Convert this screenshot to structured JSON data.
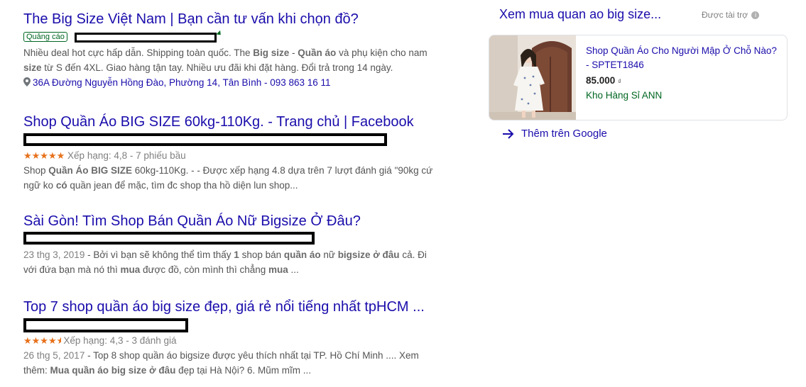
{
  "results": [
    {
      "title": "The Big Size Việt Nam | Bạn cần tư vấn khi chọn đồ?",
      "ad_badge": "Quảng cáo",
      "snippet_line1": "Nhiều deal hot cực hấp dẫn. Shipping toàn quốc. The ",
      "snippet_line1_b1": "Big size",
      "snippet_line1_mid": " - ",
      "snippet_line1_b2": "Quần áo",
      "snippet_line1_end": " và phụ kiện cho nam",
      "snippet_line2_b": "size",
      "snippet_line2": " từ S đến 4XL. Giao hàng tận tay. Nhiều ưu đãi khi đặt hàng. Đổi trả trong 14 ngày.",
      "address": "36A Đường Nguyễn Hồng Đào, Phường 14, Tân Bình - 093 863 16 11"
    },
    {
      "title": "Shop Quần Áo BIG SIZE 60kg-110Kg. - Trang chủ | Facebook",
      "stars": "★★★★★",
      "rating": "Xếp hạng: 4,8 - 7 phiếu bầu",
      "snippet_p1": "Shop ",
      "snippet_b1": "Quần Áo BIG SIZE",
      "snippet_p2": " 60kg-110Kg. - - Được xếp hạng 4.8 dựa trên 7 lượt đánh giá \"90kg cứ",
      "snippet_p3": "ngữ ko ",
      "snippet_b2": "có",
      "snippet_p4": " quần jean để mặc, tìm đc shop tha hồ diện lun shop..."
    },
    {
      "title": "Sài Gòn! Tìm Shop Bán Quần Áo Nữ Bigsize Ở Đâu?",
      "date": "23 thg 3, 2019",
      "snippet_p1": " - Bởi vì bạn sẽ không thể tìm thấy ",
      "snippet_b1": "1",
      "snippet_p2": " shop bán ",
      "snippet_b2": "quần áo",
      "snippet_p3": " nữ ",
      "snippet_b3": "bigsize ở đâu",
      "snippet_p4": " cả. Đi",
      "snippet_p5": "với đứa bạn mà nó thì ",
      "snippet_b4": "mua",
      "snippet_p6": " được đồ, còn mình thì chẳng ",
      "snippet_b5": "mua",
      "snippet_p7": " ..."
    },
    {
      "title": "Top 7 shop quần áo big size đẹp, giá rẻ nổi tiếng nhất tpHCM ...",
      "stars": "★★★★",
      "rating": "Xếp hạng: 4,3 - 3 đánh giá",
      "date": "26 thg 5, 2017",
      "snippet_p1": " - Top 8 shop quần áo bigsize được yêu thích nhất tại TP. Hồ Chí Minh .... Xem",
      "snippet_p2": "thêm: ",
      "snippet_b1": "Mua quần áo big size ở đâu",
      "snippet_p3": " đẹp tại Hà Nội? 6. Mũm mĩm ..."
    }
  ],
  "shopping": {
    "title": "Xem mua quan ao big size...",
    "sponsored": "Được tài trợ",
    "product_name": "Shop Quần Áo Cho Người Mập Ở Chỗ Nào? - SPTET1846",
    "price": "85.000",
    "currency": "₫",
    "store": "Kho Hàng Sỉ ANN",
    "more_label": "Thêm trên Google"
  },
  "colors": {
    "link": "#1a0dab",
    "green": "#006621",
    "stars": "#e7711b"
  }
}
